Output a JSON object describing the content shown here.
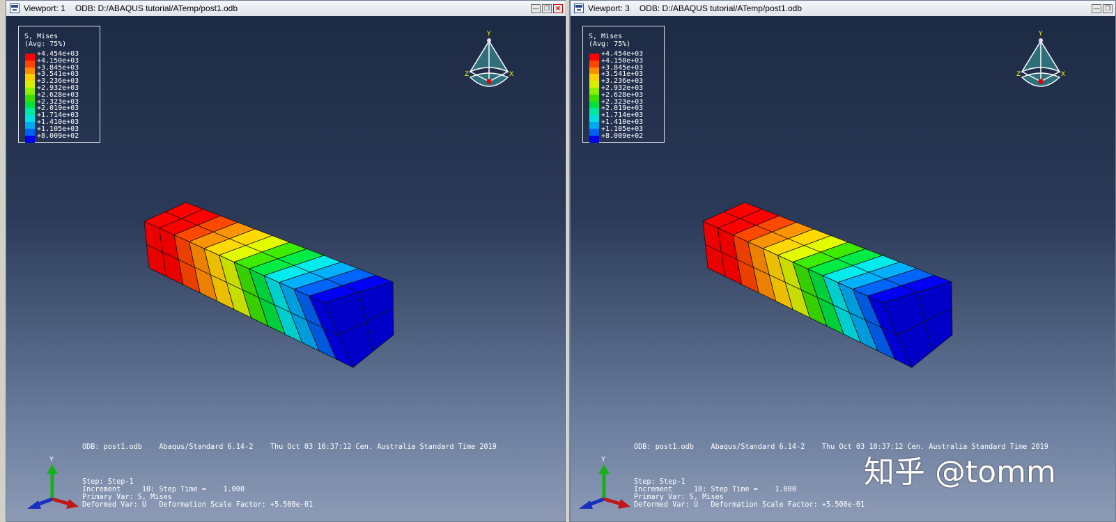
{
  "viewports": [
    {
      "title": "Viewport: 1",
      "odb_path": "ODB: D:/ABAQUS tutorial/ATemp/post1.odb",
      "has_close": true
    },
    {
      "title": "Viewport: 3",
      "odb_path": "ODB: D:/ABAQUS tutorial/ATemp/post1.odb",
      "has_close": false
    }
  ],
  "legend": {
    "title_line1": "S, Mises",
    "title_line2": "(Avg: 75%)",
    "entries": [
      {
        "label": "+4.454e+03",
        "color": "#ff0000"
      },
      {
        "label": "+4.150e+03",
        "color": "#ff4500"
      },
      {
        "label": "+3.845e+03",
        "color": "#ff8c00"
      },
      {
        "label": "+3.541e+03",
        "color": "#ffcf00"
      },
      {
        "label": "+3.236e+03",
        "color": "#d8f000"
      },
      {
        "label": "+2.932e+03",
        "color": "#8cf000"
      },
      {
        "label": "+2.628e+03",
        "color": "#3ce000"
      },
      {
        "label": "+2.323e+03",
        "color": "#00e040"
      },
      {
        "label": "+2.019e+03",
        "color": "#00e8a0"
      },
      {
        "label": "+1.714e+03",
        "color": "#00e0e0"
      },
      {
        "label": "+1.410e+03",
        "color": "#00a8f0"
      },
      {
        "label": "+1.105e+03",
        "color": "#0060f0"
      },
      {
        "label": "+8.009e+02",
        "color": "#0000e8"
      }
    ]
  },
  "triad": {
    "x": "X",
    "y": "Y",
    "z": "Z"
  },
  "info": {
    "header": "ODB: post1.odb    Abaqus/Standard 6.14-2    Thu Oct 03 10:37:12 Cen. Australia Standard Time 2019",
    "step": "Step: Step-1",
    "increment": "Increment     10: Step Time =    1.000",
    "primary": "Primary Var: S, Mises",
    "deformed": "Deformed Var: U   Deformation Scale Factor: +5.500e-01"
  },
  "watermark": "知乎 @tomm"
}
